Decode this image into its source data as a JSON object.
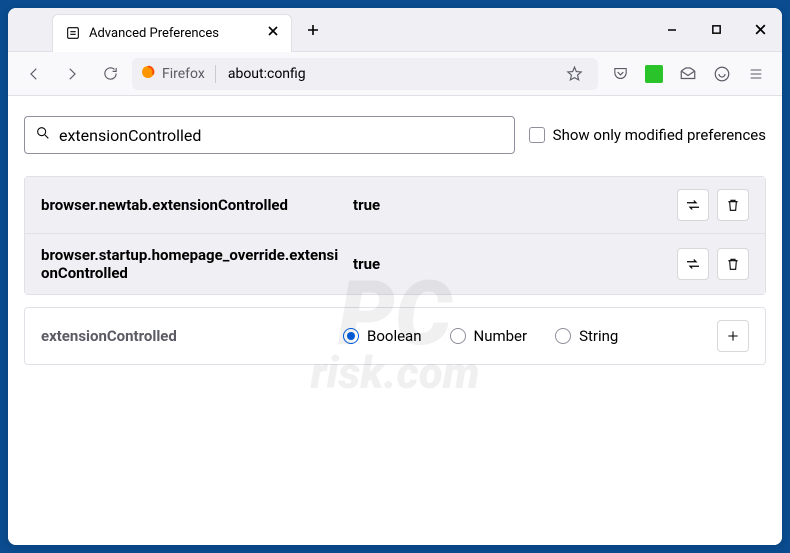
{
  "window": {
    "tab_title": "Advanced Preferences"
  },
  "toolbar": {
    "url_label": "Firefox",
    "url_value": "about:config"
  },
  "search": {
    "value": "extensionControlled",
    "checkbox_label": "Show only modified preferences",
    "checkbox_checked": false
  },
  "prefs": [
    {
      "name": "browser.newtab.extensionControlled",
      "value": "true",
      "modified": true
    },
    {
      "name": "browser.startup.homepage_override.extensionControlled",
      "value": "true",
      "modified": true
    }
  ],
  "add": {
    "name": "extensionControlled",
    "types": [
      "Boolean",
      "Number",
      "String"
    ],
    "selected": "Boolean"
  }
}
